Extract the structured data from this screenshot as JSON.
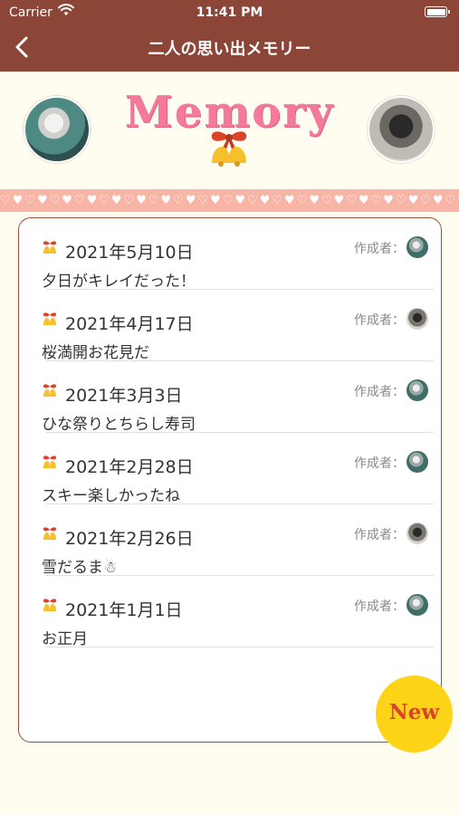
{
  "status_bar": {
    "carrier": "Carrier",
    "time": "11:41 PM"
  },
  "nav": {
    "title": "二人の思い出メモリー",
    "back_icon": "chevron-left-icon"
  },
  "banner": {
    "logo_text": "Memory",
    "bell_icon": "christmas-bells-icon",
    "accent_color": "#f47a9b"
  },
  "heart_strip": {
    "pattern": "♡♥♡♥♡♥♡♥♡♥♡♥♡♥♡♥♡♥♡♥♡♥♡♥♡♥♡♥♡♥♡♥♡♥♡♥♡♥"
  },
  "memories": [
    {
      "date": "2021年5月10日",
      "text": "夕日がキレイだった！",
      "author_label": "作成者：",
      "author": "cat"
    },
    {
      "date": "2021年4月17日",
      "text": "桜満開お花見だ",
      "author_label": "作成者：",
      "author": "dog"
    },
    {
      "date": "2021年3月3日",
      "text": "ひな祭りとちらし寿司",
      "author_label": "作成者：",
      "author": "cat"
    },
    {
      "date": "2021年2月28日",
      "text": "スキー楽しかったね",
      "author_label": "作成者：",
      "author": "cat"
    },
    {
      "date": "2021年2月26日",
      "text": "雪だるま☃",
      "author_label": "作成者：",
      "author": "dog"
    },
    {
      "date": "2021年1月1日",
      "text": "お正月",
      "author_label": "作成者：",
      "author": "cat"
    }
  ],
  "new_button": {
    "label": "New",
    "color": "#fed318"
  },
  "colors": {
    "header": "#8b4638",
    "background": "#fffdf0",
    "card_border": "#9b4d3a"
  }
}
